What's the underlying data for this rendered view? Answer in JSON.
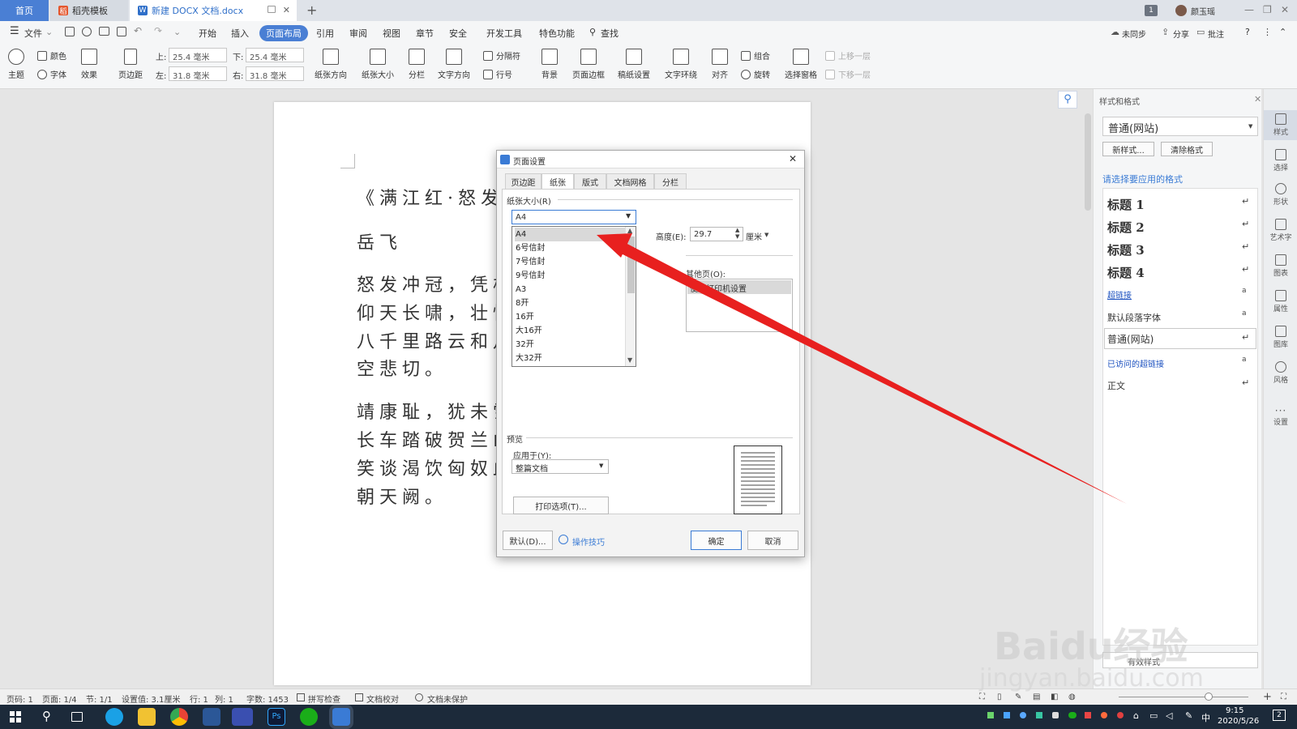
{
  "tabs": {
    "home": "首页",
    "shell": "稻壳模板",
    "doc": "新建 DOCX 文档.docx",
    "new_tab": "+"
  },
  "titlebar": {
    "badge": "1",
    "user": "颜玉瑶"
  },
  "menu": {
    "file": "文件",
    "items": [
      "开始",
      "插入",
      "页面布局",
      "引用",
      "审阅",
      "视图",
      "章节",
      "安全",
      "开发工具",
      "特色功能"
    ],
    "search": "查找",
    "right": [
      "未同步",
      "分享",
      "批注"
    ]
  },
  "ribbon": {
    "theme": "主题",
    "colors": "颜色",
    "fonts": "字体",
    "effects": "效果",
    "margins": "页边距",
    "top_label": "上:",
    "top_value": "25.4 毫米",
    "bottom_label": "下:",
    "bottom_value": "25.4 毫米",
    "left_label": "左:",
    "left_value": "31.8 毫米",
    "right_label": "右:",
    "right_value": "31.8 毫米",
    "orientation": "纸张方向",
    "size": "纸张大小",
    "columns": "分栏",
    "text_direction": "文字方向",
    "breaks": "分隔符",
    "line_numbers": "行号",
    "background": "背景",
    "page_border": "页面边框",
    "paper_settings": "稿纸设置",
    "wrap": "文字环绕",
    "align": "对齐",
    "group": "组合",
    "rotate": "旋转",
    "selection_pane": "选择窗格",
    "bring_forward": "上移一层",
    "send_backward": "下移一层"
  },
  "document": {
    "lines": [
      "《满江红·怒发",
      "岳飞",
      "怒发冲冠，凭栏",
      "仰天长啸，壮怀",
      "八千里路云和月",
      "空悲切。",
      "靖康耻，犹未雪",
      "长车踏破贺兰山",
      "笑谈渴饮匈奴血",
      "朝天阙。"
    ]
  },
  "dialog": {
    "title": "页面设置",
    "tabs": [
      "页边距",
      "纸张",
      "版式",
      "文档网格",
      "分栏"
    ],
    "paper_size_label": "纸张大小(R)",
    "selected_size": "A4",
    "size_options": [
      "A4",
      "6号信封",
      "7号信封",
      "9号信封",
      "A3",
      "8开",
      "16开",
      "大16开",
      "32开",
      "大32开"
    ],
    "height_label": "高度(E):",
    "height_value": "29.7",
    "unit": "厘米",
    "other_pages_label": "其他页(O):",
    "other_pages_value": "使用打印机设置",
    "preview_label": "预览",
    "apply_to_label": "应用于(Y):",
    "apply_to_value": "整篇文档",
    "print_options": "打印选项(T)...",
    "default_btn": "默认(D)...",
    "tips": "操作技巧",
    "ok": "确定",
    "cancel": "取消"
  },
  "style_panel": {
    "title": "样式和格式",
    "current": "普通(网站)",
    "new_style": "新样式...",
    "clear_format": "清除格式",
    "prompt": "请选择要应用的格式",
    "styles": [
      "标题 1",
      "标题 2",
      "标题 3",
      "标题 4",
      "超链接",
      "默认段落字体",
      "普通(网站)",
      "已访问的超链接",
      "正文"
    ],
    "bottom_select": "有效样式"
  },
  "sidebar": [
    "样式",
    "选择",
    "形状",
    "艺术字",
    "图表",
    "属性",
    "图库",
    "风格",
    "设置"
  ],
  "status": {
    "page": "页码: 1",
    "pages": "页面: 1/4",
    "section": "节: 1/1",
    "setting": "设置值: 3.1厘米",
    "row": "行: 1",
    "col": "列: 1",
    "words": "字数: 1453",
    "spell": "拼写检查",
    "proof": "文档校对",
    "protect": "文档未保护"
  },
  "taskbar": {
    "ime": "中",
    "time": "9:15",
    "date": "2020/5/26",
    "notif": "2"
  },
  "watermark": {
    "text": "Baidu经验",
    "url": "jingyan.baidu.com"
  },
  "colors": {
    "accent": "#4a7fd4",
    "arrow": "#e8201f",
    "taskbar": "#1c2a3a"
  }
}
